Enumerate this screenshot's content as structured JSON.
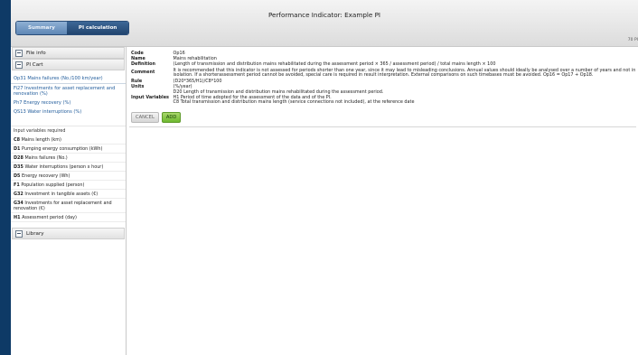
{
  "header": {
    "title": "Performance Indicator: Example PI",
    "tabs": [
      {
        "label": "Summary"
      },
      {
        "label": "PI calculation"
      }
    ],
    "zoom": "70 PI"
  },
  "sidebar": {
    "file_info": "File info",
    "pi_cart": "PI Cart",
    "cart_items": [
      "Op31 Mains failures (No./100 km/year)",
      "Fi27 Investments for asset replacement and renovation (%)",
      "Ph7 Energy recovery (%)",
      "QS13 Water interruptions (%)"
    ],
    "required_label": "Input variables required",
    "variables": [
      {
        "code": "C8",
        "name": "Mains length (km)"
      },
      {
        "code": "D1",
        "name": "Pumping energy consumption (kWh)"
      },
      {
        "code": "D28",
        "name": "Mains failures (No.)"
      },
      {
        "code": "D35",
        "name": "Water interruptions (person x hour)"
      },
      {
        "code": "D5",
        "name": "Energy recovery (Wh)"
      },
      {
        "code": "F1",
        "name": "Population supplied (person)"
      },
      {
        "code": "G32",
        "name": "Investment in tangible assets (€)"
      },
      {
        "code": "G34",
        "name": "Investments for asset replacement and renovation (€)"
      },
      {
        "code": "H1",
        "name": "Assessment period (day)"
      }
    ],
    "library": "Library"
  },
  "detail": {
    "code_label": "Code",
    "code": "Op16",
    "name_label": "Name",
    "name": "Mains rehabilitation",
    "definition_label": "Definition",
    "definition": "(Length of transmission and distribution mains rehabilitated during the assessment period × 365 / assessment period) / total mains length × 100",
    "comment_label": "Comment",
    "comment": "It is recommended that this indicator is not assessed for periods shorter than one year, since it may lead to misleading conclusions. Annual values should ideally be analysed over a number of years and not in isolation. If a shorterassessment period cannot be avoided, special care is required in result interpretation. External comparisons on such timebases must be avoided. Op16 = Op17 + Op18.",
    "rule_label": "Rule",
    "rule": "(D20*365/H1)/C8*100",
    "units_label": "Units",
    "units": "(%/year)",
    "inputs_label": "Input Variables",
    "inputs": [
      "D20 Length of transmission and distribution mains rehabilitated during the assessment period.",
      "H1 Period of time adopted for the assessment of the data and of the PI.",
      "C8 Total transmission and distribution mains length (service connections not included), at the reference date"
    ],
    "cancel": "CANCEL",
    "add": "ADD"
  }
}
